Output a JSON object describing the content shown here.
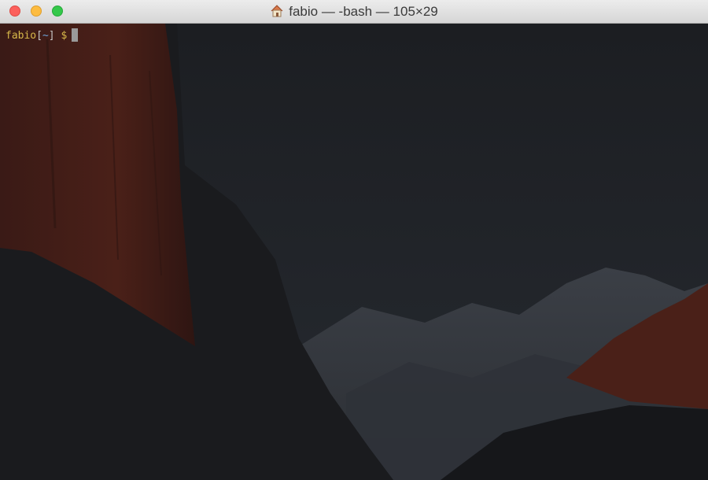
{
  "window": {
    "title": "fabio — -bash — 105×29"
  },
  "terminal": {
    "prompt_user": "fabio",
    "prompt_open": "[",
    "prompt_dir": "~",
    "prompt_close": "]",
    "prompt_symbol": "$"
  },
  "colors": {
    "prompt_user": "#d8b94a",
    "prompt_dir": "#6fa3d8",
    "background": "#1e2024"
  },
  "icons": {
    "title_icon": "home-icon"
  }
}
